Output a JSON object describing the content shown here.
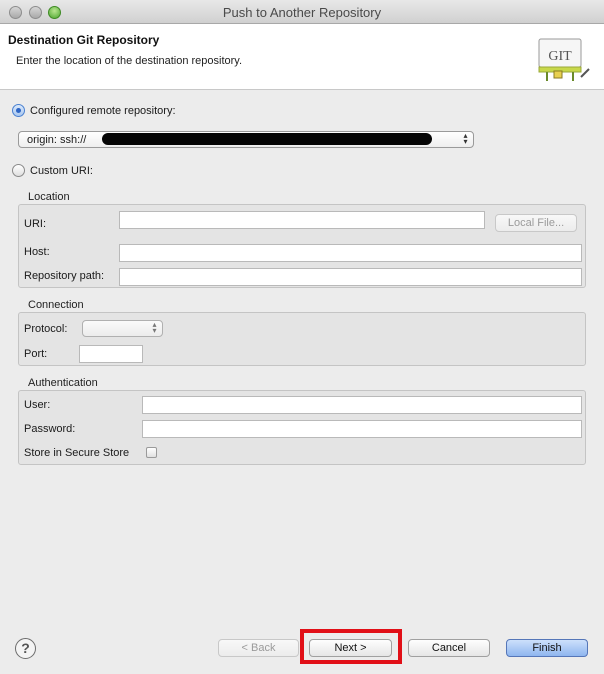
{
  "window": {
    "title": "Push to Another Repository"
  },
  "header": {
    "title": "Destination Git Repository",
    "description": "Enter the location of the destination repository.",
    "logo_text": "GIT"
  },
  "configured": {
    "label": "Configured remote repository:",
    "selected_value": "origin: ssh://",
    "selected": true
  },
  "custom": {
    "label": "Custom URI:",
    "selected": false
  },
  "location": {
    "title": "Location",
    "uri_label": "URI:",
    "uri_value": "",
    "local_file_button": "Local File...",
    "host_label": "Host:",
    "host_value": "",
    "repo_path_label": "Repository path:",
    "repo_path_value": ""
  },
  "connection": {
    "title": "Connection",
    "protocol_label": "Protocol:",
    "protocol_value": "",
    "port_label": "Port:",
    "port_value": ""
  },
  "authentication": {
    "title": "Authentication",
    "user_label": "User:",
    "user_value": "",
    "password_label": "Password:",
    "password_value": "",
    "secure_store_label": "Store in Secure Store",
    "secure_store_checked": false
  },
  "footer": {
    "help": "?",
    "back": "< Back",
    "next": "Next >",
    "cancel": "Cancel",
    "finish": "Finish"
  },
  "colors": {
    "highlight": "#e10f17",
    "primary_button": "#8fb6ef"
  },
  "icons": {
    "help": "help-icon",
    "logo": "git-logo-icon",
    "dropdown": "updown-arrows-icon"
  }
}
